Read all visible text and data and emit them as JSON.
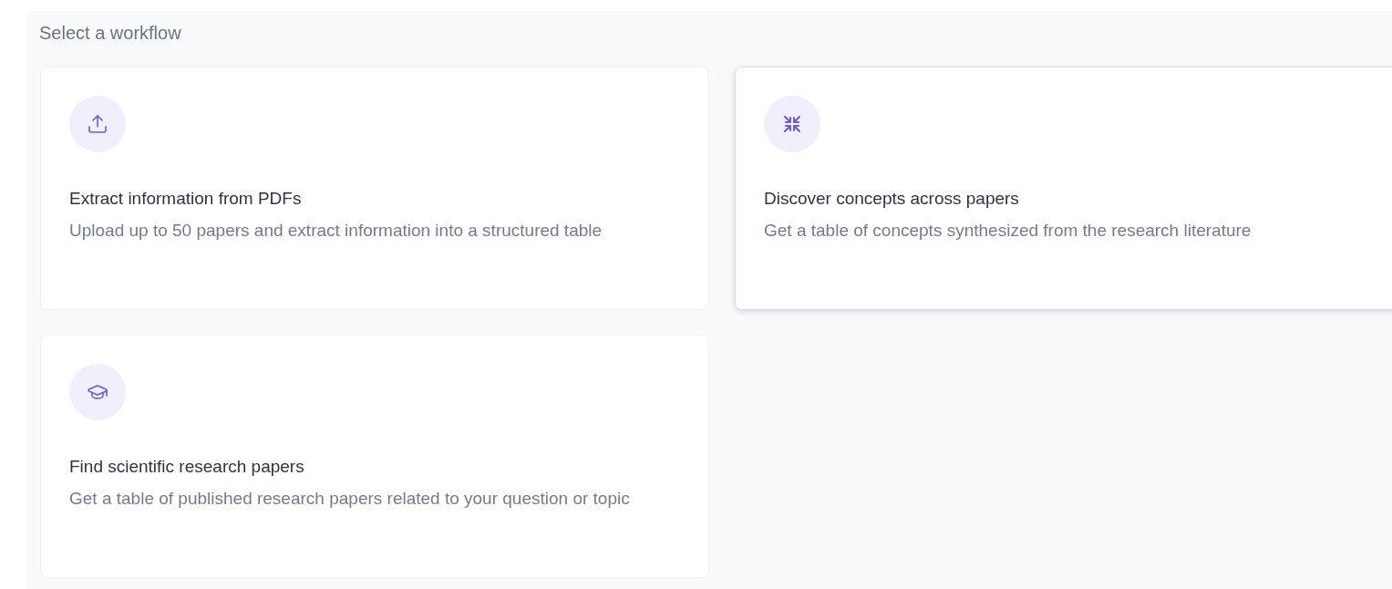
{
  "heading": "Select a workflow",
  "workflows": [
    {
      "kind": "upload",
      "title": "Extract information from PDFs",
      "description": "Upload up to 50 papers and extract information into a structured table",
      "highlighted": false
    },
    {
      "kind": "converge",
      "title": "Discover concepts across papers",
      "description": "Get a table of concepts synthesized from the research literature",
      "highlighted": true
    },
    {
      "kind": "graduation",
      "title": "Find scientific research papers",
      "description": "Get a table of published research papers related to your question or topic",
      "highlighted": false
    }
  ]
}
